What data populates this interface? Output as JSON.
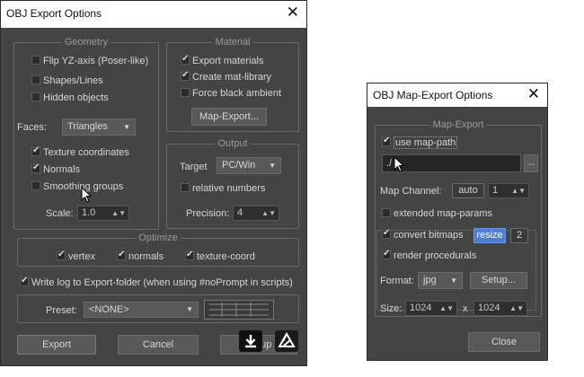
{
  "export_window": {
    "title": "OBJ Export Options",
    "geometry": {
      "title": "Geometry",
      "flip_yz": {
        "label": "Flip YZ-axis (Poser-like)",
        "checked": false
      },
      "shapes_lines": {
        "label": "Shapes/Lines",
        "checked": false
      },
      "hidden_objects": {
        "label": "Hidden objects",
        "checked": false
      },
      "faces_label": "Faces:",
      "faces_value": "Triangles",
      "texture_coordinates": {
        "label": "Texture coordinates",
        "checked": true
      },
      "normals": {
        "label": "Normals",
        "checked": true
      },
      "smoothing_groups": {
        "label": "Smoothing groups",
        "checked": false
      },
      "scale_label": "Scale:",
      "scale_value": "1.0"
    },
    "material": {
      "title": "Material",
      "export_materials": {
        "label": "Export materials",
        "checked": true
      },
      "create_mat_library": {
        "label": "Create mat-library",
        "checked": true
      },
      "force_black_ambient": {
        "label": "Force black ambient",
        "checked": false
      },
      "map_export_button": "Map-Export..."
    },
    "output": {
      "title": "Output",
      "target_label": "Target",
      "target_value": "PC/Win",
      "relative_numbers": {
        "label": "relative numbers",
        "checked": false
      },
      "precision_label": "Precision:",
      "precision_value": "4"
    },
    "optimize": {
      "title": "Optimize",
      "vertex": {
        "label": "vertex",
        "checked": true
      },
      "normals": {
        "label": "normals",
        "checked": true
      },
      "texture_coord": {
        "label": "texture-coord",
        "checked": true
      }
    },
    "write_log": {
      "label": "Write log to Export-folder (when using #noPrompt in scripts)",
      "checked": true
    },
    "preset_label": "Preset:",
    "preset_value": "<NONE>",
    "buttons": {
      "export": "Export",
      "cancel": "Cancel",
      "setup": "Setup"
    }
  },
  "map_window": {
    "title": "OBJ Map-Export Options",
    "group_title": "Map-Export",
    "use_map_path": {
      "label": "use map-path",
      "checked": true
    },
    "path_value": "./",
    "browse_button": "...",
    "map_channel_label": "Map Channel:",
    "auto_button": "auto",
    "channel_value": "1",
    "extended_map_params": {
      "label": "extended map-params",
      "checked": false
    },
    "convert_bitmaps": {
      "label": "convert bitmaps",
      "checked": true
    },
    "resize_button": "resize",
    "pow2_button": "2",
    "render_procedurals": {
      "label": "render procedurals",
      "checked": true
    },
    "format_label": "Format:",
    "format_value": "jpg",
    "setup_button": "Setup...",
    "size_label": "Size:",
    "size_w": "1024",
    "size_x": "x",
    "size_h": "1024",
    "close_button": "Close"
  },
  "colors": {
    "panel": "#444444",
    "accent": "#4a7fd4",
    "titlebar": "#ffffff"
  }
}
